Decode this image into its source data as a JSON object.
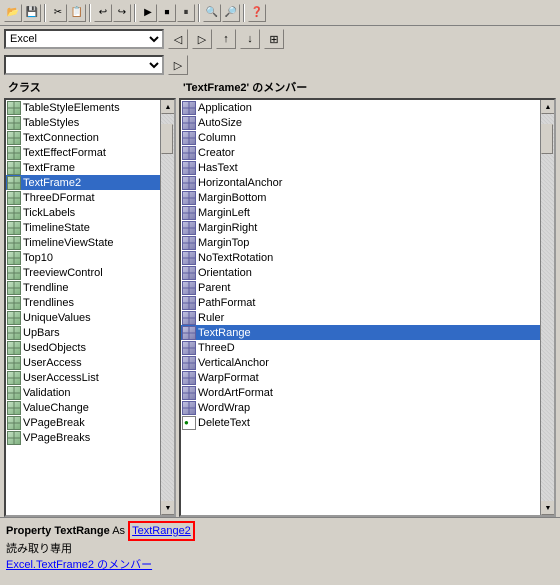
{
  "toolbar": {
    "icons": [
      "📂",
      "💾",
      "✂",
      "📋",
      "↩",
      "↪",
      "▶",
      "⏹",
      "⏸",
      "🔍",
      "🔎",
      "❓"
    ]
  },
  "combo1": {
    "value": "Excel",
    "options": [
      "Excel"
    ]
  },
  "combo2": {
    "value": "",
    "options": [
      ""
    ]
  },
  "nav_buttons": [
    "◀",
    "▶",
    "◀◀",
    "▶▶"
  ],
  "nav_buttons2": [
    "◁"
  ],
  "class_label": "クラス",
  "member_label_prefix": "'TextFrame2' のメンバー",
  "classes": [
    "TableStyleElements",
    "TableStyles",
    "TextConnection",
    "TextEffectFormat",
    "TextFrame",
    "TextFrame2",
    "ThreeDFormat",
    "TickLabels",
    "TimelineState",
    "TimelineViewState",
    "Top10",
    "TreeviewControl",
    "Trendline",
    "Trendlines",
    "UniqueValues",
    "UpBars",
    "UsedObjects",
    "UserAccess",
    "UserAccessList",
    "Validation",
    "ValueChange",
    "VPageBreak",
    "VPageBreaks"
  ],
  "members": [
    "Application",
    "AutoSize",
    "Column",
    "Creator",
    "HasText",
    "HorizontalAnchor",
    "MarginBottom",
    "MarginLeft",
    "MarginRight",
    "MarginTop",
    "NoTextRotation",
    "Orientation",
    "Parent",
    "PathFormat",
    "Ruler",
    "TextRange",
    "ThreeD",
    "VerticalAnchor",
    "WarpFormat",
    "WordArtFormat",
    "WordWrap",
    "DeleteText"
  ],
  "selected_class": "TextFrame2",
  "selected_member": "TextRange",
  "status": {
    "property_label": "Property",
    "property_name": "TextRange",
    "as_label": "As",
    "type_name": "TextRange2",
    "readonly_label": "読み取り専用",
    "member_of_label": "Excel.TextFrame2 のメンバー"
  }
}
